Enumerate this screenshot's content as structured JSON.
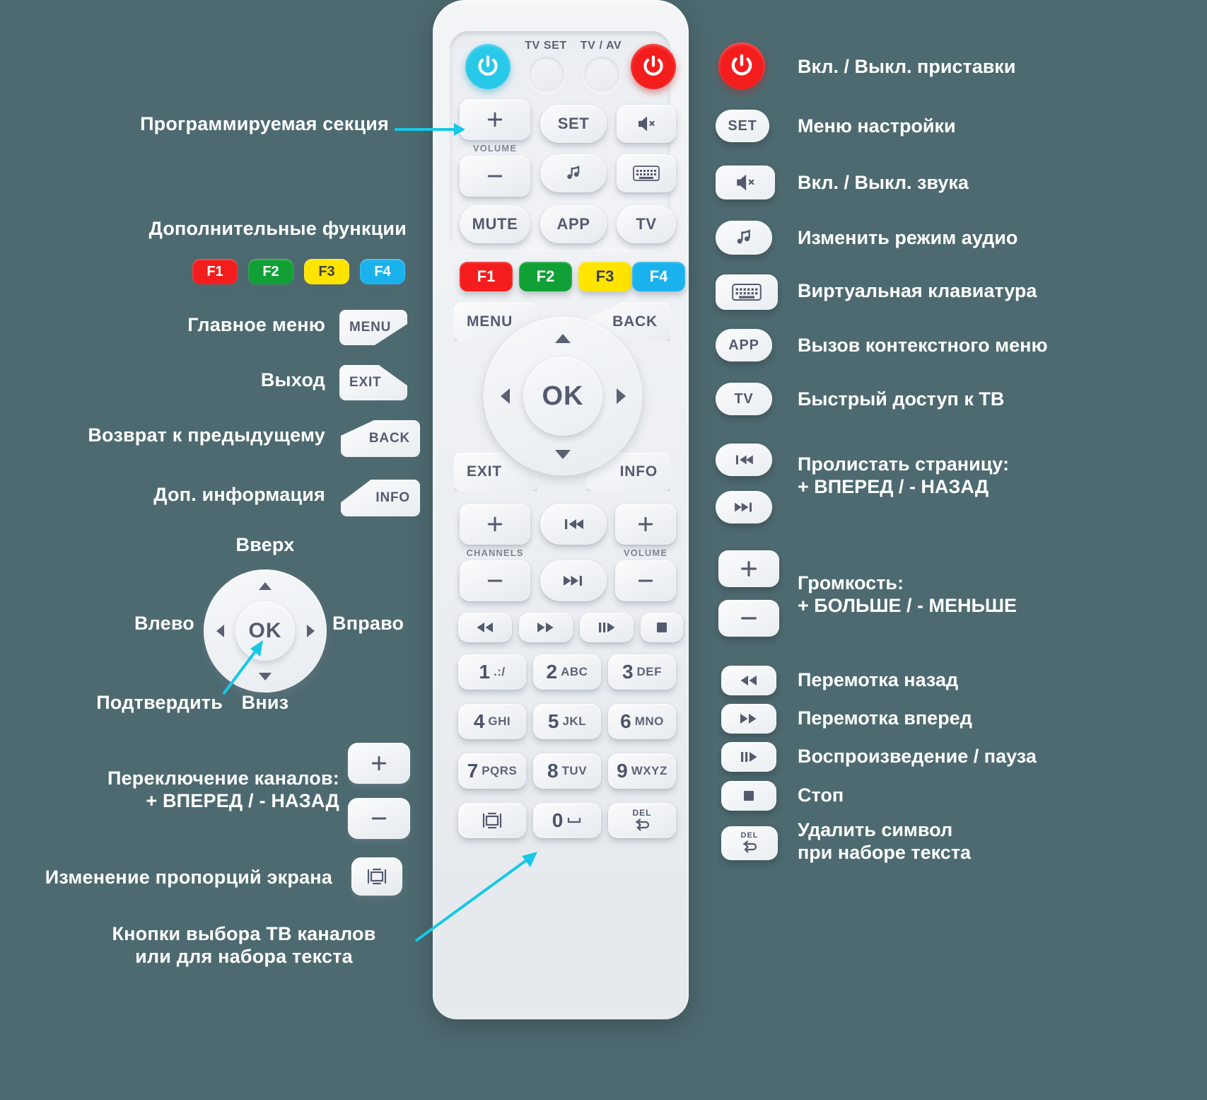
{
  "meta": {
    "bg_color": "#4d6a70",
    "accent_cyan": "#18c8e6",
    "power_red": "#f41d1d",
    "power_cyan": "#28c8e8",
    "key_text_color": "#545b6e"
  },
  "remote": {
    "top_panel": {
      "power_standby_icon": "power-icon",
      "tv_set_label": "TV SET",
      "tv_av_label": "TV / AV",
      "power_main_icon": "power-icon",
      "volume_up": "+",
      "volume_caption": "VOLUME",
      "volume_down": "—",
      "mute_label": "MUTE",
      "set_label": "SET",
      "audio_icon": "music-note-icon",
      "app_label": "APP",
      "mute_icon": "speaker-mute-icon",
      "keyboard_icon": "keyboard-icon",
      "tv_label": "TV"
    },
    "fkeys": [
      {
        "label": "F1",
        "color": "#f41d1d",
        "text": "#ffffff"
      },
      {
        "label": "F2",
        "color": "#10a035",
        "text": "#ffffff"
      },
      {
        "label": "F3",
        "color": "#ffe400",
        "text": "#3b3f4c"
      },
      {
        "label": "F4",
        "color": "#1ab2ec",
        "text": "#ffffff"
      }
    ],
    "nav": {
      "menu_label": "MENU",
      "back_label": "BACK",
      "exit_label": "EXIT",
      "info_label": "INFO",
      "ok_label": "OK"
    },
    "channels_volume": {
      "channels_plus": "+",
      "channels_caption": "CHANNELS",
      "channels_minus": "—",
      "page_prev_icon": "skip-back-icon",
      "page_next_icon": "skip-forward-icon",
      "volume_plus": "+",
      "volume_caption": "VOLUME",
      "volume_minus": "—"
    },
    "transport": {
      "rewind_icon": "rewind-icon",
      "forward_icon": "fast-forward-icon",
      "play_pause_icon": "play-pause-icon",
      "stop_icon": "stop-icon"
    },
    "keypad": [
      {
        "digit": "1",
        "letters": ".:/"
      },
      {
        "digit": "2",
        "letters": "ABC"
      },
      {
        "digit": "3",
        "letters": "DEF"
      },
      {
        "digit": "4",
        "letters": "GHI"
      },
      {
        "digit": "5",
        "letters": "JKL"
      },
      {
        "digit": "6",
        "letters": "MNO"
      },
      {
        "digit": "7",
        "letters": "PQRS"
      },
      {
        "digit": "8",
        "letters": "TUV"
      },
      {
        "digit": "9",
        "letters": "WXYZ"
      }
    ],
    "bottom_row": {
      "aspect_icon": "aspect-ratio-icon",
      "zero_digit": "0",
      "space_icon": "space-underscore-icon",
      "del_label": "DEL",
      "del_icon": "delete-loop-icon"
    }
  },
  "left_labels": {
    "programmable_section": "Программируемая секция",
    "extra_functions": "Дополнительные функции",
    "main_menu": "Главное меню",
    "exit": "Выход",
    "back_to_previous": "Возврат к предыдущему",
    "extra_info": "Доп. информация",
    "up": "Вверх",
    "left": "Влево",
    "right": "Вправо",
    "down": "Вниз",
    "confirm": "Подтвердить",
    "channel_switch": "Переключение каналов:\n+ ВПЕРЕД / - НАЗАД",
    "aspect_change": "Изменение пропорций экрана",
    "tv_channel_buttons": "Кнопки выбора ТВ каналов\nили для набора текста",
    "fkeys": [
      {
        "label": "F1",
        "color": "#f41d1d",
        "text": "#ffffff"
      },
      {
        "label": "F2",
        "color": "#10a035",
        "text": "#ffffff"
      },
      {
        "label": "F3",
        "color": "#ffe400",
        "text": "#3b3f4c"
      },
      {
        "label": "F4",
        "color": "#1ab2ec",
        "text": "#ffffff"
      }
    ],
    "menu_chip": "MENU",
    "exit_chip": "EXIT",
    "back_chip": "BACK",
    "info_chip": "INFO",
    "ok_chip": "OK",
    "plus_chip": "+",
    "minus_chip": "—",
    "aspect_chip": "aspect-ratio-icon"
  },
  "right_legend": [
    {
      "icon": "power-icon",
      "chip": "",
      "text": "Вкл. / Выкл. приставки"
    },
    {
      "icon": "",
      "chip": "SET",
      "text": "Меню настройки"
    },
    {
      "icon": "speaker-mute-icon",
      "chip": "",
      "text": "Вкл. / Выкл. звука"
    },
    {
      "icon": "music-note-icon",
      "chip": "",
      "text": "Изменить режим аудио"
    },
    {
      "icon": "keyboard-icon",
      "chip": "",
      "text": "Виртуальная клавиатура"
    },
    {
      "icon": "",
      "chip": "APP",
      "text": "Вызов контекстного меню"
    },
    {
      "icon": "",
      "chip": "TV",
      "text": "Быстрый доступ к ТВ"
    },
    {
      "icon": "skip-back-icon",
      "chip": "",
      "text": "Пролистать страницу:\n+ ВПЕРЕД / - НАЗАД"
    },
    {
      "icon": "skip-forward-icon",
      "chip": "",
      "text": ""
    },
    {
      "icon": "",
      "chip": "+",
      "text": "Громкость:\n+ БОЛЬШЕ / - МЕНЬШЕ"
    },
    {
      "icon": "",
      "chip": "—",
      "text": ""
    },
    {
      "icon": "rewind-icon",
      "chip": "",
      "text": "Перемотка назад"
    },
    {
      "icon": "fast-forward-icon",
      "chip": "",
      "text": "Перемотка вперед"
    },
    {
      "icon": "play-pause-icon",
      "chip": "",
      "text": "Воспроизведение / пауза"
    },
    {
      "icon": "stop-icon",
      "chip": "",
      "text": "Стоп"
    },
    {
      "icon": "delete-loop-icon",
      "chip": "DEL",
      "text": "Удалить символ\nпри наборе текста"
    }
  ]
}
